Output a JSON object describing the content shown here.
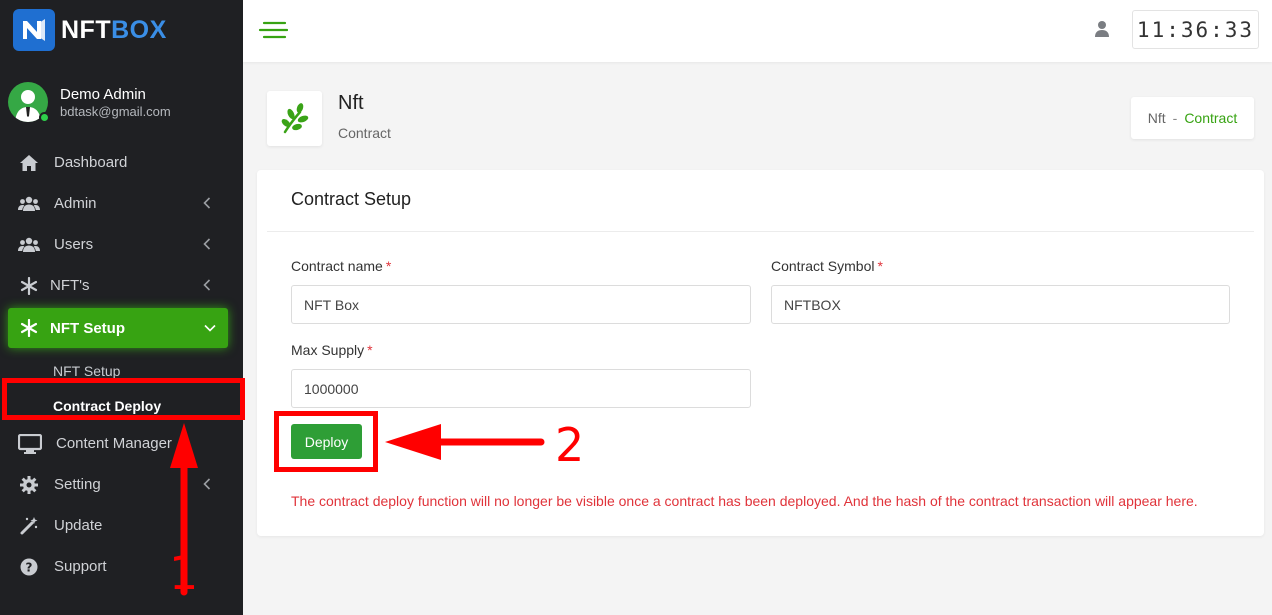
{
  "brand": {
    "name_part1": "NFT",
    "name_part2": "BOX"
  },
  "user": {
    "name": "Demo Admin",
    "email": "bdtask@gmail.com"
  },
  "sidebar": {
    "items": [
      {
        "label": "Dashboard",
        "icon": "home-icon"
      },
      {
        "label": "Admin",
        "icon": "users-icon"
      },
      {
        "label": "Users",
        "icon": "users-icon"
      },
      {
        "label": "NFT's",
        "icon": "snowflake-icon"
      },
      {
        "label": "NFT Setup",
        "icon": "snowflake-icon"
      },
      {
        "label": "Content Manager",
        "icon": "monitor-icon"
      },
      {
        "label": "Setting",
        "icon": "gear-icon"
      },
      {
        "label": "Update",
        "icon": "magic-wand-icon"
      },
      {
        "label": "Support",
        "icon": "question-circle-icon"
      }
    ],
    "submenu": [
      {
        "label": "NFT Setup"
      },
      {
        "label": "Contract Deploy"
      }
    ]
  },
  "topbar": {
    "clock": "11:36:33"
  },
  "page": {
    "title": "Nft",
    "subtitle": "Contract",
    "breadcrumb": {
      "parent": "Nft",
      "separator": "-",
      "current": "Contract"
    }
  },
  "card": {
    "title": "Contract Setup",
    "contract_name": {
      "label": "Contract name",
      "required_mark": "*",
      "value": "NFT Box"
    },
    "contract_symbol": {
      "label": "Contract Symbol",
      "required_mark": "*",
      "value": "NFTBOX"
    },
    "max_supply": {
      "label": "Max Supply",
      "required_mark": "*",
      "value": "1000000"
    },
    "deploy_label": "Deploy",
    "notice": "The contract deploy function will no longer be visible once a contract has been deployed. And the hash of the contract transaction will appear here."
  },
  "annotations": {
    "step1": "1",
    "step2": "2"
  },
  "colors": {
    "accent": "#37a312",
    "sidebar_bg": "#1f2023",
    "annotation": "#ff0000",
    "required": "#e0333a"
  }
}
